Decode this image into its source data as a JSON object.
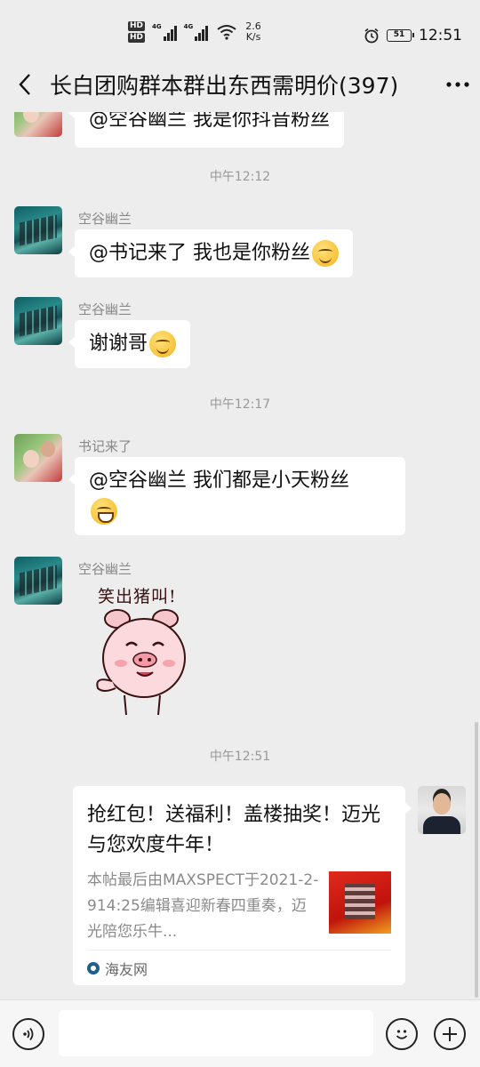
{
  "status_bar": {
    "hd1": "HD",
    "hd2": "HD",
    "net1": "4G",
    "net2": "4G",
    "speed_value": "2.6",
    "speed_unit": "K/s",
    "battery": "51",
    "time": "12:51"
  },
  "header": {
    "title": "长白团购群本群出东西需明价(397)"
  },
  "icons": {
    "back": "chevron-left-icon",
    "more": "more-dots-icon",
    "voice": "voice-icon",
    "emoji": "emoji-icon",
    "add": "plus-icon"
  },
  "messages": {
    "partial": {
      "text": "@空谷幽兰  我是你抖音粉丝"
    },
    "ts1": "中午12:12",
    "m1": {
      "sender": "空谷幽兰",
      "text": "@书记来了  我也是你粉丝"
    },
    "m2": {
      "sender": "空谷幽兰",
      "text": "谢谢哥"
    },
    "ts2": "中午12:17",
    "m3": {
      "sender": "书记来了",
      "text": "@空谷幽兰  我们都是小天粉丝"
    },
    "m4": {
      "sender": "空谷幽兰",
      "sticker_caption": "笑出猪叫!"
    },
    "ts3": "中午12:51",
    "m5": {
      "title": "抢红包！送福利！盖楼抽奖！迈光与您欢度牛年！",
      "description": "本帖最后由MAXSPECT于2021-2-914:25编辑喜迎新春四重奏，迈光陪您乐牛...",
      "source": "海友网"
    }
  },
  "input": {
    "value": ""
  },
  "colors": {
    "background": "#ededed",
    "bubble": "#ffffff",
    "timestamp": "#999999",
    "sender": "#888888"
  }
}
